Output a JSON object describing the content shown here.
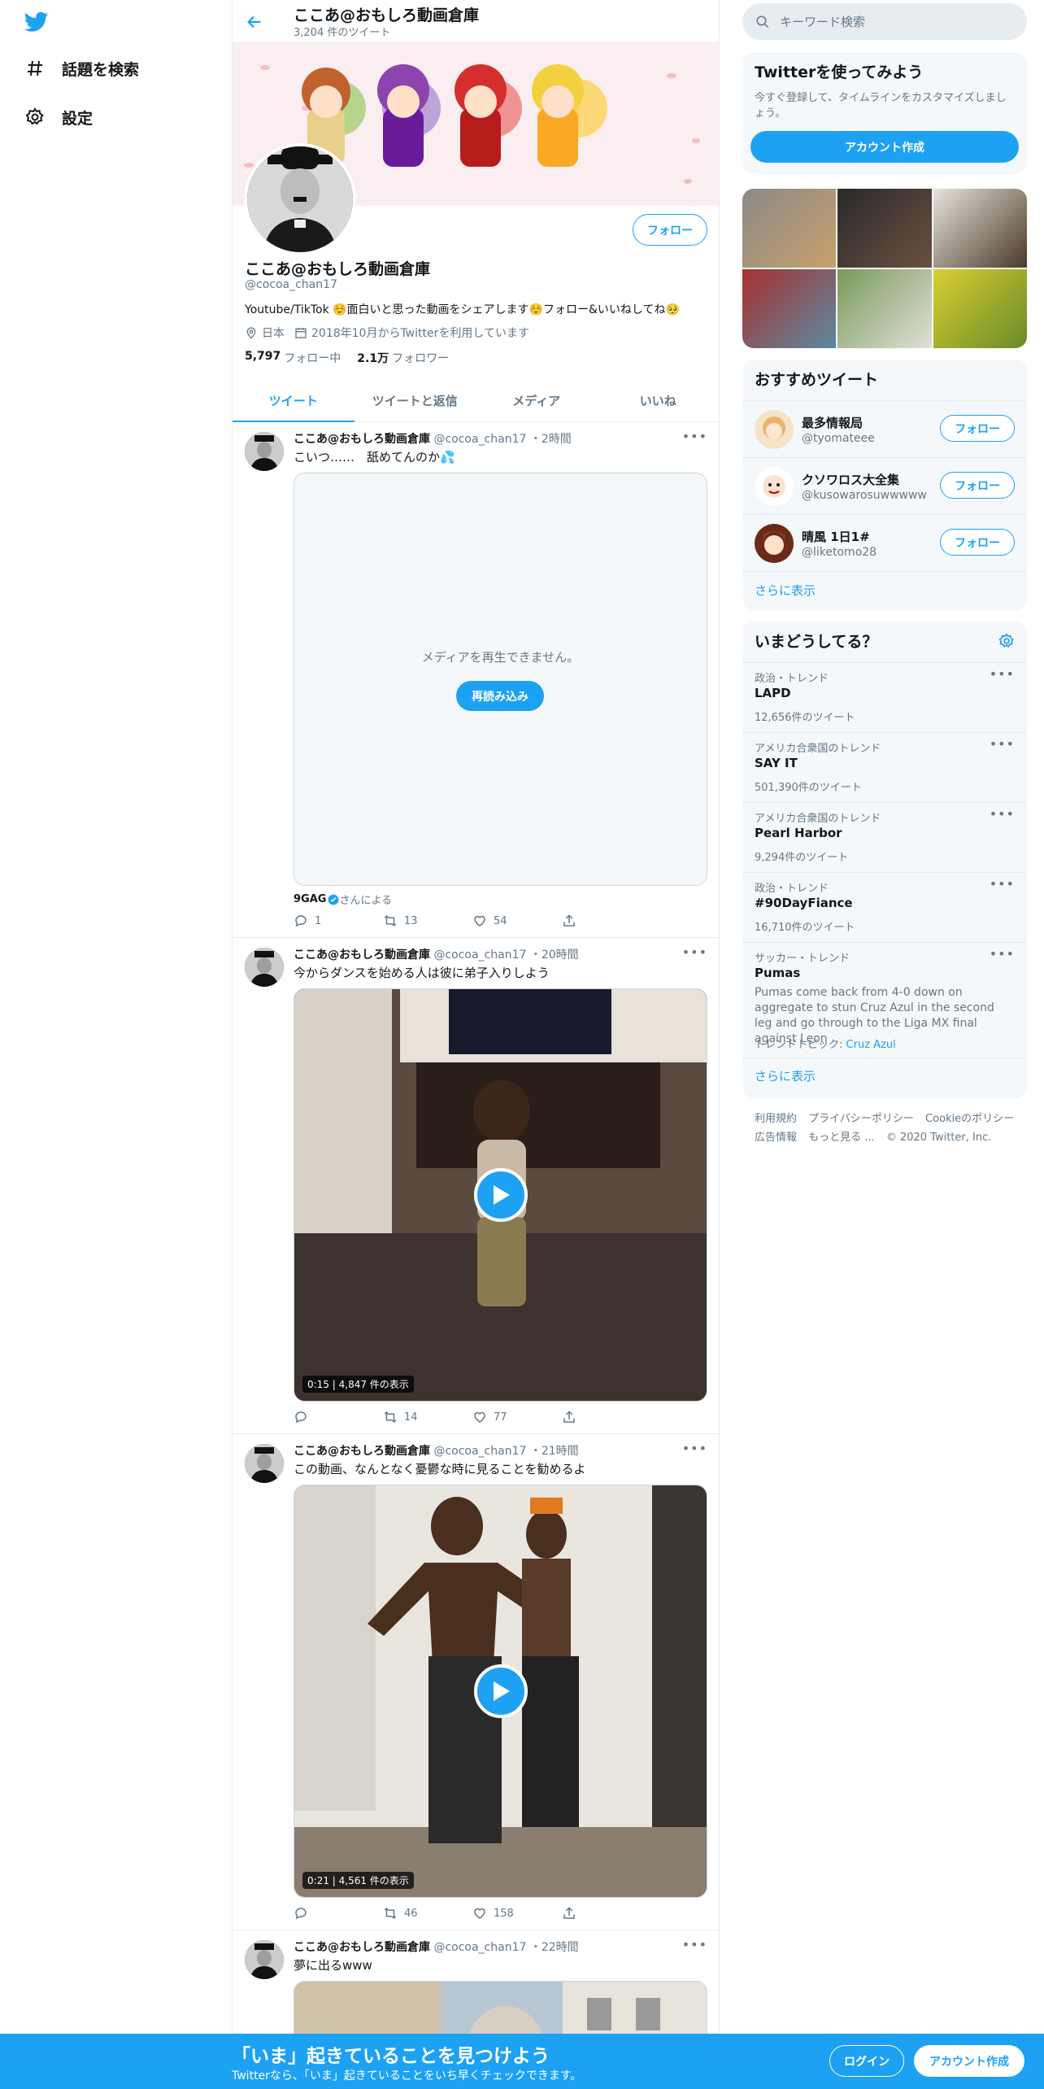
{
  "nav": {
    "items": [
      {
        "label": "話題を検索",
        "icon": "hashtag-icon"
      },
      {
        "label": "設定",
        "icon": "gear-icon"
      }
    ]
  },
  "header": {
    "title": "ここあ@おもしろ動画倉庫",
    "tweet_count": "3,204 件のツイート"
  },
  "profile": {
    "name": "ここあ@おもしろ動画倉庫",
    "handle": "@cocoa_chan17",
    "bio": "Youtube/TikTok ☺️面白いと思った動画をシェアします☺️フォロー&いいねしてね🥺",
    "location": "日本",
    "joined": "2018年10月からTwitterを利用しています",
    "following_count": "5,797",
    "following_label": "フォロー中",
    "followers_count": "2.1万",
    "followers_label": "フォロワー",
    "follow_button": "フォロー"
  },
  "tabs": [
    {
      "label": "ツイート",
      "active": true
    },
    {
      "label": "ツイートと返信",
      "active": false
    },
    {
      "label": "メディア",
      "active": false
    },
    {
      "label": "いいね",
      "active": false
    }
  ],
  "tweets": [
    {
      "name": "ここあ@おもしろ動画倉庫",
      "handle": "@cocoa_chan17",
      "time": "・2時間",
      "text": "こいつ……　舐めてんのか💦",
      "media_error": "メディアを再生できません。",
      "reload": "再読み込み",
      "source_name": "9GAG",
      "source_suffix": "さんによる",
      "replies": "1",
      "retweets": "13",
      "likes": "54"
    },
    {
      "name": "ここあ@おもしろ動画倉庫",
      "handle": "@cocoa_chan17",
      "time": "・20時間",
      "text": "今からダンスを始める人は彼に弟子入りしよう",
      "duration": "0:15",
      "views": "4,847 件の表示",
      "replies": "",
      "retweets": "14",
      "likes": "77"
    },
    {
      "name": "ここあ@おもしろ動画倉庫",
      "handle": "@cocoa_chan17",
      "time": "・21時間",
      "text": "この動画、なんとなく憂鬱な時に見ることを勧めるよ",
      "duration": "0:21",
      "views": "4,561 件の表示",
      "replies": "",
      "retweets": "46",
      "likes": "158"
    },
    {
      "name": "ここあ@おもしろ動画倉庫",
      "handle": "@cocoa_chan17",
      "time": "・22時間",
      "text": "夢に出るwww"
    }
  ],
  "sidebar": {
    "search_placeholder": "キーワード検索",
    "signup": {
      "title": "Twitterを使ってみよう",
      "desc": "今すぐ登録して、タイムラインをカスタマイズしましょう。",
      "button": "アカウント作成"
    },
    "recommended": {
      "title": "おすすめツイート",
      "users": [
        {
          "name": "最多情報局",
          "handle": "@tyomateee",
          "button": "フォロー"
        },
        {
          "name": "クソワロス大全集",
          "handle": "@kusowarosuwwwww",
          "button": "フォロー"
        },
        {
          "name": "晴風 1日1#",
          "handle": "@liketomo28",
          "button": "フォロー"
        }
      ],
      "more": "さらに表示"
    },
    "trends": {
      "title": "いまどうしてる？",
      "items": [
        {
          "context": "政治・トレンド",
          "name": "LAPD",
          "count": "12,656件のツイート"
        },
        {
          "context": "アメリカ合衆国のトレンド",
          "name": "SAY IT",
          "count": "501,390件のツイート"
        },
        {
          "context": "アメリカ合衆国のトレンド",
          "name": "Pearl Harbor",
          "count": "9,294件のツイート"
        },
        {
          "context": "政治・トレンド",
          "name": "#90DayFiance",
          "count": "16,710件のツイート"
        },
        {
          "context": "サッカー・トレンド",
          "name": "Pumas",
          "desc": "Pumas come back from 4-0 down on aggregate to stun Cruz Azul in the second leg and go through to the Liga MX final against Leon",
          "topic_label": "トレンドトピック:",
          "topic": "Cruz Azul"
        }
      ],
      "more": "さらに表示"
    },
    "footer": {
      "links": [
        "利用規約",
        "プライバシーポリシー",
        "Cookieのポリシー",
        "広告情報",
        "もっと見る ..."
      ],
      "copyright": "© 2020 Twitter, Inc."
    }
  },
  "bottom_bar": {
    "title": "「いま」起きていることを見つけよう",
    "subtitle": "Twitterなら、「いま」起きていることをいち早くチェックできます。",
    "login": "ログイン",
    "signup": "アカウント作成"
  },
  "colors": {
    "accent": "#1da1f2",
    "text": "#14171a",
    "muted": "#657786",
    "border": "#e6ecf0"
  }
}
